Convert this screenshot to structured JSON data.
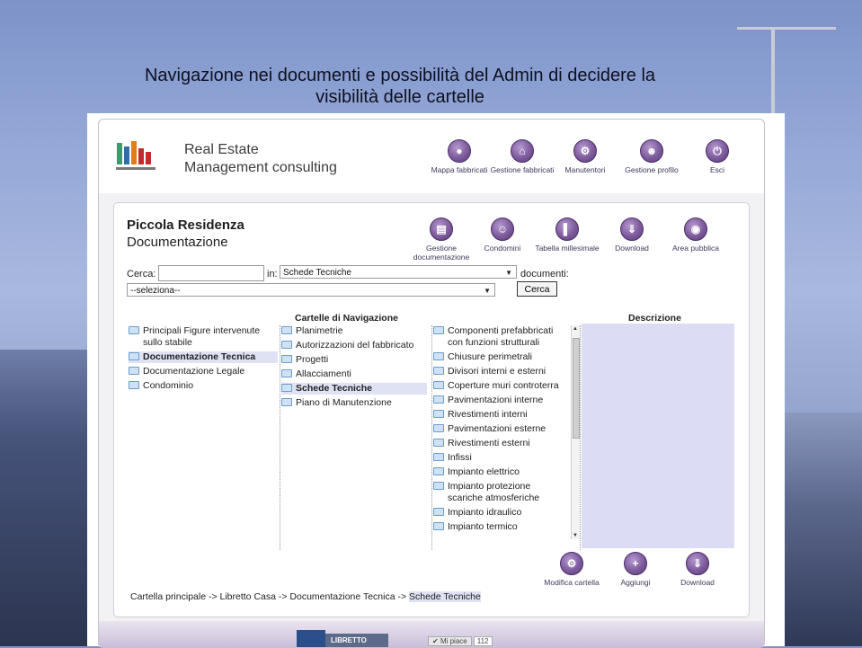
{
  "slide": {
    "title_line1": "Navigazione nei documenti e possibilità del Admin di decidere la",
    "title_line2": "visibilità delle cartelle"
  },
  "header": {
    "brand_line1": "Real Estate",
    "brand_line2": "Management consulting",
    "nav": [
      {
        "label": "Mappa fabbricati",
        "icon": "location-pin-icon"
      },
      {
        "label": "Gestione fabbricati",
        "icon": "home-icon"
      },
      {
        "label": "Manutentori",
        "icon": "tools-icon"
      },
      {
        "label": "Gestione profilo",
        "icon": "user-profile-icon"
      },
      {
        "label": "Esci",
        "icon": "power-icon"
      }
    ]
  },
  "page": {
    "title": "Piccola Residenza",
    "subtitle": "Documentazione"
  },
  "sub_nav": [
    {
      "label": "Gestione documentazione",
      "icon": "document-icon"
    },
    {
      "label": "Condomini",
      "icon": "people-icon"
    },
    {
      "label": "Tabella millesimale",
      "icon": "bar-chart-icon"
    },
    {
      "label": "Download",
      "icon": "zip-download-icon"
    },
    {
      "label": "Area pubblica",
      "icon": "public-area-icon"
    }
  ],
  "search": {
    "cerca_label": "Cerca:",
    "in_label": "in:",
    "scope_value": "Schede Tecniche",
    "documenti_label": "documenti:",
    "filter_value": "--seleziona--",
    "button_label": "Cerca"
  },
  "columns": {
    "nav_header": "Cartelle di Navigazione",
    "desc_header": "Descrizione"
  },
  "tree_col1": [
    {
      "label": "Principali Figure intervenute sullo stabile",
      "selected": false
    },
    {
      "label": "Documentazione Tecnica",
      "selected": true
    },
    {
      "label": "Documentazione Legale",
      "selected": false
    },
    {
      "label": "Condominio",
      "selected": false
    }
  ],
  "tree_col2": [
    {
      "label": "Planimetrie",
      "selected": false
    },
    {
      "label": "Autorizzazioni del fabbricato",
      "selected": false
    },
    {
      "label": "Progetti",
      "selected": false
    },
    {
      "label": "Allacciamenti",
      "selected": false
    },
    {
      "label": "Schede Tecniche",
      "selected": true
    },
    {
      "label": "Piano di Manutenzione",
      "selected": false
    }
  ],
  "tree_col3": [
    {
      "label": "Componenti prefabbricati con funzioni strutturali"
    },
    {
      "label": "Chiusure perimetrali"
    },
    {
      "label": "Divisori interni e esterni"
    },
    {
      "label": "Coperture muri controterra"
    },
    {
      "label": "Pavimentazioni interne"
    },
    {
      "label": "Rivestimenti interni"
    },
    {
      "label": "Pavimentazioni esterne"
    },
    {
      "label": "Rivestimenti esterni"
    },
    {
      "label": "Infissi"
    },
    {
      "label": "Impianto elettrico"
    },
    {
      "label": "Impianto protezione scariche atmosferiche"
    },
    {
      "label": "Impianto idraulico"
    },
    {
      "label": "Impianto termico"
    }
  ],
  "actions": [
    {
      "label": "Modifica cartella",
      "icon": "settings-icon"
    },
    {
      "label": "Aggiungi",
      "icon": "add-icon"
    },
    {
      "label": "Download",
      "icon": "zip-download-icon"
    }
  ],
  "breadcrumb": {
    "path": "Cartella principale -> Libretto Casa -> Documentazione Tecnica -> ",
    "current": "Schede Tecniche"
  },
  "footer": {
    "libretto_label": "LIBRETTO",
    "like_label": "Mi piace",
    "like_count": "112"
  },
  "colors": {
    "accent": "#7d5a9c",
    "selection": "#dfe2f3",
    "description_bg": "#dcdcf4"
  }
}
